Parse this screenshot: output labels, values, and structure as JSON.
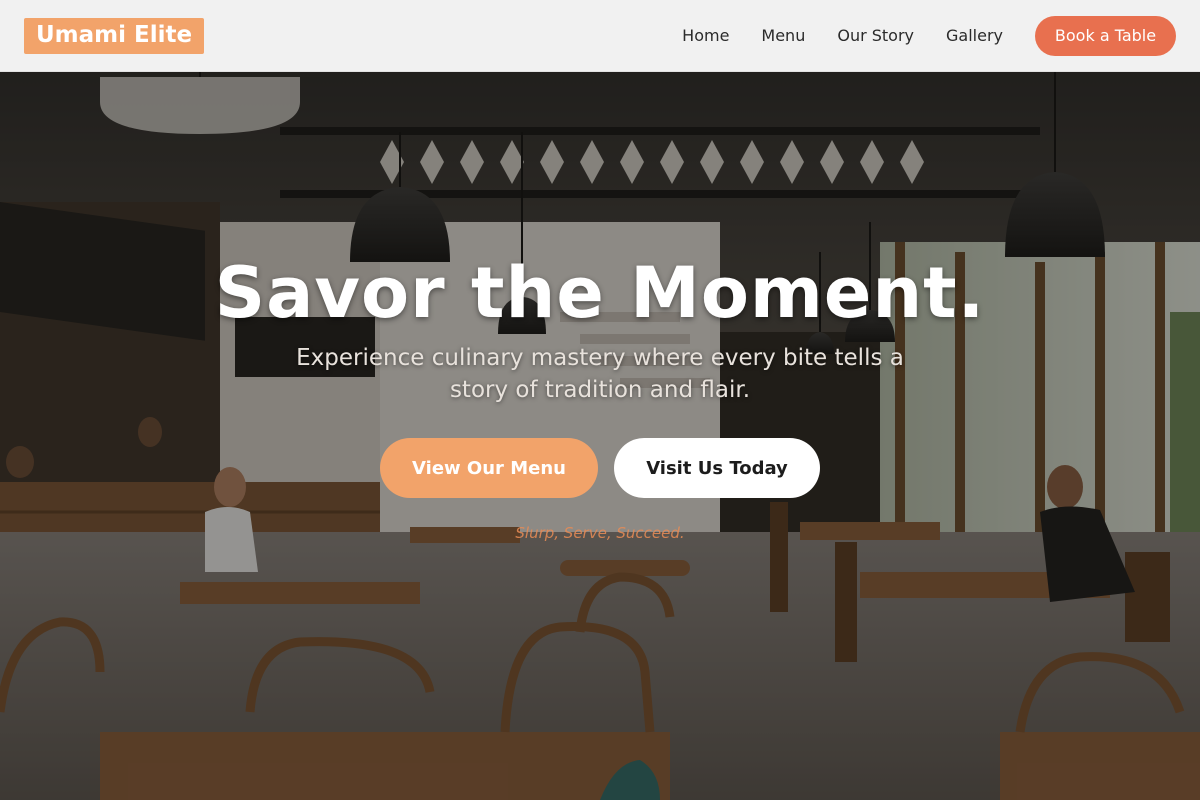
{
  "brand": {
    "name": "Umami Elite"
  },
  "nav": {
    "links": [
      {
        "label": "Home"
      },
      {
        "label": "Menu"
      },
      {
        "label": "Our Story"
      },
      {
        "label": "Gallery"
      }
    ],
    "cta_label": "Book a Table"
  },
  "hero": {
    "headline": "Savor the Moment.",
    "subtitle": "Experience culinary mastery where every bite tells a story of tradition and flair.",
    "primary_cta": "View Our Menu",
    "secondary_cta": "Visit Us Today",
    "tagline": "Slurp, Serve, Succeed."
  },
  "colors": {
    "accent": "#f2a36a",
    "book_button": "#e8704f",
    "header_bg": "#f1f1f1",
    "tagline": "#e98c55"
  }
}
